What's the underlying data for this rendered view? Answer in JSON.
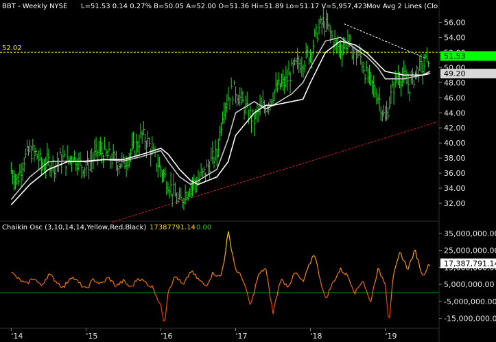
{
  "header": {
    "symbol": "BBT - Weekly  NYSE",
    "quote": "L=51.53  0.14  0.27%  B=50.05  A=52.00  O=51.36  Hi=51.89  Lo=51.17  V=5,957,423",
    "indicator": "Mov Avg 2 Lines (Clo"
  },
  "oscillator": {
    "label": "Chaikin Osc (3,10,14,14,Yellow,Red,Black)",
    "value": "17387791.14",
    "change": "0.00"
  },
  "colors": {
    "background": "#000000",
    "bars": "#22dd22",
    "ma_fast": "#c8c8c8",
    "ma_slow": "#ffffff",
    "resistance_line": "#ffff00",
    "downtrend_line": "#ffffff",
    "uptrend_line": "#dd2222",
    "osc_high": "#ffdd00",
    "osc_low": "#ee2200",
    "zero_line": "#00aa00",
    "last_price_flag": "#00ff00",
    "ma_flag": "#d8d8d8"
  },
  "chart_data": [
    {
      "type": "line",
      "title": "BBT - Weekly",
      "x_axis": {
        "ticks": [
          "'14",
          "'15",
          "'16",
          "'17",
          "'18",
          "'19"
        ]
      },
      "y_axis": {
        "ticks": [
          32.0,
          34.0,
          36.0,
          38.0,
          40.0,
          42.0,
          44.0,
          46.0,
          48.0,
          50.0,
          52.0,
          54.0,
          56.0
        ],
        "range": [
          30.0,
          57.5
        ],
        "position": "right"
      },
      "series": [
        {
          "style": "weekly-hlc-bars",
          "x": [
            2014.0,
            2014.083,
            2014.167,
            2014.25,
            2014.333,
            2014.417,
            2014.5,
            2014.583,
            2014.667,
            2014.75,
            2014.833,
            2014.917,
            2015.0,
            2015.083,
            2015.167,
            2015.25,
            2015.333,
            2015.417,
            2015.5,
            2015.583,
            2015.667,
            2015.75,
            2015.833,
            2015.917,
            2016.0,
            2016.083,
            2016.167,
            2016.25,
            2016.333,
            2016.417,
            2016.5,
            2016.583,
            2016.667,
            2016.75,
            2016.833,
            2016.917,
            2017.0,
            2017.083,
            2017.167,
            2017.25,
            2017.333,
            2017.417,
            2017.5,
            2017.583,
            2017.667,
            2017.75,
            2017.833,
            2017.917,
            2018.0,
            2018.083,
            2018.167,
            2018.25,
            2018.333,
            2018.417,
            2018.5,
            2018.583,
            2018.667,
            2018.75,
            2018.833,
            2018.917,
            2019.0,
            2019.083,
            2019.167,
            2019.25,
            2019.333,
            2019.417,
            2019.5,
            2019.583
          ],
          "values": [
            36.4,
            35.0,
            37.8,
            39.0,
            38.5,
            37.0,
            37.5,
            37.0,
            38.0,
            37.5,
            38.5,
            37.2,
            36.8,
            37.8,
            39.0,
            38.5,
            38.0,
            37.5,
            37.2,
            38.5,
            39.5,
            41.0,
            40.0,
            38.0,
            36.5,
            35.0,
            33.5,
            32.0,
            33.5,
            34.5,
            35.0,
            36.0,
            37.5,
            38.5,
            44.5,
            46.5,
            47.0,
            45.5,
            44.0,
            43.0,
            44.5,
            45.0,
            46.5,
            47.5,
            48.0,
            49.5,
            50.5,
            51.0,
            52.0,
            54.5,
            56.0,
            55.0,
            53.0,
            52.5,
            53.5,
            52.0,
            51.5,
            49.0,
            47.5,
            46.0,
            43.0,
            46.5,
            49.0,
            48.5,
            47.5,
            49.5,
            50.0,
            51.53
          ]
        },
        {
          "style": "moving-average-fast",
          "x": [
            2014.0,
            2014.25,
            2014.5,
            2014.75,
            2015.0,
            2015.25,
            2015.5,
            2015.75,
            2016.0,
            2016.1,
            2016.25,
            2016.4,
            2016.5,
            2016.75,
            2016.9,
            2017.0,
            2017.25,
            2017.4,
            2017.5,
            2017.75,
            2017.9,
            2018.0,
            2018.2,
            2018.4,
            2018.6,
            2018.75,
            2018.9,
            2019.0,
            2019.25,
            2019.5,
            2019.6
          ],
          "values": [
            32.5,
            35.5,
            37.5,
            37.6,
            37.5,
            37.8,
            37.6,
            38.2,
            39.0,
            37.5,
            35.5,
            34.5,
            35.0,
            36.5,
            40.5,
            44.0,
            45.5,
            44.5,
            45.0,
            46.5,
            48.0,
            50.0,
            53.5,
            54.0,
            52.5,
            51.5,
            50.0,
            48.5,
            48.5,
            49.0,
            49.5
          ]
        },
        {
          "style": "moving-average-slow",
          "x": [
            2014.0,
            2014.25,
            2014.5,
            2014.75,
            2015.0,
            2015.25,
            2015.5,
            2015.75,
            2016.0,
            2016.1,
            2016.25,
            2016.4,
            2016.5,
            2016.75,
            2016.9,
            2017.0,
            2017.25,
            2017.4,
            2017.5,
            2017.75,
            2017.9,
            2018.0,
            2018.2,
            2018.4,
            2018.6,
            2018.75,
            2018.9,
            2019.0,
            2019.25,
            2019.5,
            2019.6
          ],
          "values": [
            31.8,
            34.5,
            36.5,
            37.5,
            37.6,
            37.8,
            37.8,
            38.5,
            39.3,
            38.5,
            36.5,
            35.0,
            34.5,
            35.5,
            37.5,
            41.0,
            44.0,
            45.0,
            45.0,
            45.5,
            45.8,
            48.0,
            52.0,
            53.5,
            53.0,
            52.0,
            50.5,
            49.5,
            49.0,
            49.0,
            49.2
          ]
        }
      ],
      "reference_lines": [
        {
          "kind": "horizontal",
          "value": 52.02,
          "label": "52.02"
        },
        {
          "kind": "trendline-resistance",
          "points": [
            [
              2018.45,
              55.8
            ],
            [
              2019.55,
              51.2
            ]
          ]
        },
        {
          "kind": "trendline-support",
          "points": [
            [
              2015.35,
              29.5
            ],
            [
              2019.7,
              42.8
            ]
          ]
        }
      ],
      "flags": [
        {
          "label": "51.53",
          "value": 51.53
        },
        {
          "label": "49.20",
          "value": 49.2
        }
      ],
      "grid": false
    },
    {
      "type": "line",
      "title": "Chaikin Osc (3,10,14,14,Yellow,Red,Black)",
      "y_axis": {
        "ticks": [
          "35,000,000.00",
          "25,000,000.00",
          "15,000,000.00",
          "5,000,000.00",
          "-5,000,000.00",
          "-15,000,000.00"
        ],
        "range": [
          -20000000,
          39000000
        ],
        "position": "right"
      },
      "zero_line": 0,
      "series": [
        {
          "x": [
            2014.0,
            2014.1,
            2014.2,
            2014.3,
            2014.4,
            2014.5,
            2014.6,
            2014.7,
            2014.8,
            2014.9,
            2015.0,
            2015.1,
            2015.2,
            2015.3,
            2015.4,
            2015.5,
            2015.6,
            2015.7,
            2015.8,
            2015.9,
            2016.0,
            2016.05,
            2016.1,
            2016.2,
            2016.3,
            2016.4,
            2016.5,
            2016.6,
            2016.7,
            2016.8,
            2016.85,
            2016.9,
            2017.0,
            2017.1,
            2017.2,
            2017.3,
            2017.4,
            2017.5,
            2017.6,
            2017.7,
            2017.8,
            2017.9,
            2018.0,
            2018.05,
            2018.1,
            2018.2,
            2018.3,
            2018.4,
            2018.5,
            2018.6,
            2018.7,
            2018.8,
            2018.85,
            2018.9,
            2019.0,
            2019.05,
            2019.1,
            2019.2,
            2019.3,
            2019.4,
            2019.5,
            2019.55,
            2019.6
          ],
          "values": [
            12000000,
            8000000,
            5000000,
            9000000,
            4000000,
            11000000,
            7000000,
            3000000,
            10000000,
            6000000,
            2000000,
            8000000,
            5000000,
            9000000,
            4000000,
            7000000,
            3000000,
            9000000,
            6000000,
            3000000,
            -8000000,
            -18000000,
            2000000,
            10000000,
            4000000,
            13000000,
            8000000,
            4000000,
            12000000,
            9000000,
            20000000,
            36000000,
            14000000,
            8000000,
            -8000000,
            10000000,
            15000000,
            -12000000,
            8000000,
            4000000,
            12000000,
            6000000,
            18000000,
            24000000,
            14000000,
            -4000000,
            6000000,
            14000000,
            10000000,
            0,
            8000000,
            -6000000,
            4000000,
            14000000,
            6000000,
            -18000000,
            8000000,
            24000000,
            14000000,
            25000000,
            10000000,
            14000000,
            17387791.14
          ]
        }
      ],
      "flags": [
        {
          "label": "17,387,791.14",
          "value": 17387791.14
        }
      ],
      "grid": false
    }
  ]
}
